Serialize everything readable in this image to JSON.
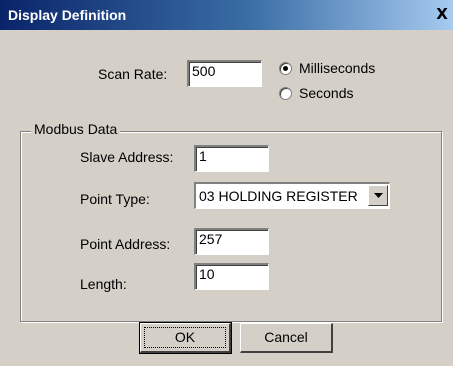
{
  "window": {
    "title": "Display Definition",
    "close_label": "X"
  },
  "scan": {
    "label": "Scan Rate:",
    "value": "500",
    "options": [
      {
        "label": "Milliseconds",
        "checked": true
      },
      {
        "label": "Seconds",
        "checked": false
      }
    ]
  },
  "modbus": {
    "group_label": "Modbus Data",
    "slave_address": {
      "label": "Slave Address:",
      "value": "1"
    },
    "point_type": {
      "label": "Point Type:",
      "value": "03 HOLDING REGISTER"
    },
    "point_address": {
      "label": "Point Address:",
      "value": "257"
    },
    "length": {
      "label": "Length:",
      "value": "10"
    }
  },
  "buttons": {
    "ok": "OK",
    "cancel": "Cancel"
  }
}
